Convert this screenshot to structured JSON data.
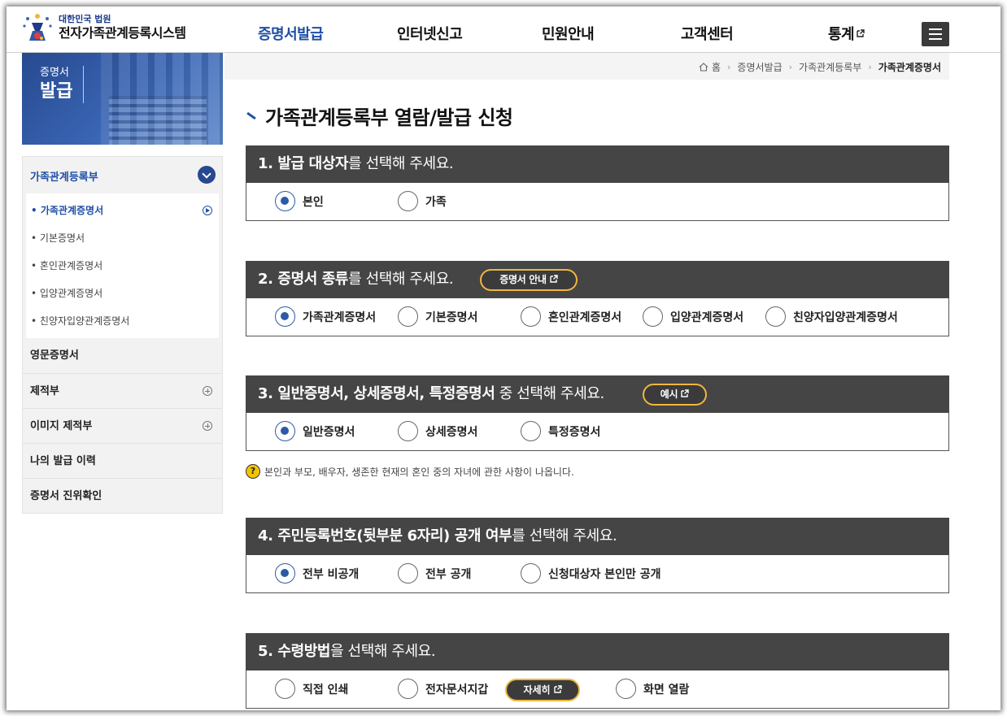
{
  "header": {
    "logo_sub": "대한민국 법원",
    "logo_main": "전자가족관계등록시스템",
    "nav": [
      {
        "label": "증명서발급",
        "active": true
      },
      {
        "label": "인터넷신고",
        "active": false
      },
      {
        "label": "민원안내",
        "active": false
      },
      {
        "label": "고객센터",
        "active": false
      },
      {
        "label": "통계",
        "active": false,
        "external": true
      }
    ],
    "menu_icon": "hamburger-icon"
  },
  "sidebar": {
    "banner_line1": "증명서",
    "banner_line2": "발급",
    "top_label": "가족관계등록부",
    "sub_items": [
      {
        "label": "• 가족관계증명서",
        "active": true
      },
      {
        "label": "• 기본증명서",
        "active": false
      },
      {
        "label": "• 혼인관계증명서",
        "active": false
      },
      {
        "label": "• 입양관계증명서",
        "active": false
      },
      {
        "label": "• 친양자입양관계증명서",
        "active": false
      }
    ],
    "main_items": [
      {
        "label": "영문증명서",
        "expandable": false
      },
      {
        "label": "제적부",
        "expandable": true
      },
      {
        "label": "이미지 제적부",
        "expandable": true
      },
      {
        "label": "나의 발급 이력",
        "expandable": false
      },
      {
        "label": "증명서 진위확인",
        "expandable": false
      }
    ]
  },
  "breadcrumb": {
    "home": "홈",
    "items": [
      "증명서발급",
      "가족관계등록부",
      "가족관계증명서"
    ]
  },
  "page_title": "가족관계등록부 열람/발급 신청",
  "sections": [
    {
      "bold": "1. 발급 대상자",
      "rest": "를 선택해 주세요.",
      "options": [
        {
          "label": "본인",
          "checked": true
        },
        {
          "label": "가족",
          "checked": false
        }
      ]
    },
    {
      "bold": "2. 증명서 종류",
      "rest": "를 선택해 주세요.",
      "pill": "증명서 안내",
      "options": [
        {
          "label": "가족관계증명서",
          "checked": true
        },
        {
          "label": "기본증명서",
          "checked": false
        },
        {
          "label": "혼인관계증명서",
          "checked": false
        },
        {
          "label": "입양관계증명서",
          "checked": false
        },
        {
          "label": "친양자입양관계증명서",
          "checked": false
        }
      ]
    },
    {
      "bold": "3. 일반증명서, 상세증명서, 특정증명서",
      "rest": " 중 선택해 주세요.",
      "pill": "예시",
      "options": [
        {
          "label": "일반증명서",
          "checked": true
        },
        {
          "label": "상세증명서",
          "checked": false
        },
        {
          "label": "특정증명서",
          "checked": false
        }
      ],
      "help": "본인과 부모, 배우자, 생존한 현재의 혼인 중의 자녀에 관한 사항이 나옵니다."
    },
    {
      "bold": "4. 주민등록번호(뒷부분 6자리) 공개 여부",
      "rest": "를 선택해 주세요.",
      "options": [
        {
          "label": "전부 비공개",
          "checked": true
        },
        {
          "label": "전부 공개",
          "checked": false
        },
        {
          "label": "신청대상자 본인만 공개",
          "checked": false
        }
      ]
    },
    {
      "bold": "5. 수령방법",
      "rest": "을 선택해 주세요.",
      "options": [
        {
          "label": "직접 인쇄",
          "checked": false
        },
        {
          "label": "전자문서지갑",
          "checked": false
        },
        {
          "label": "화면 열람",
          "checked": false
        }
      ],
      "detail_pill": "자세히"
    }
  ],
  "colors": {
    "accent": "#1f4fa6",
    "section_header": "#454545",
    "pill_border": "#f0b73f"
  }
}
